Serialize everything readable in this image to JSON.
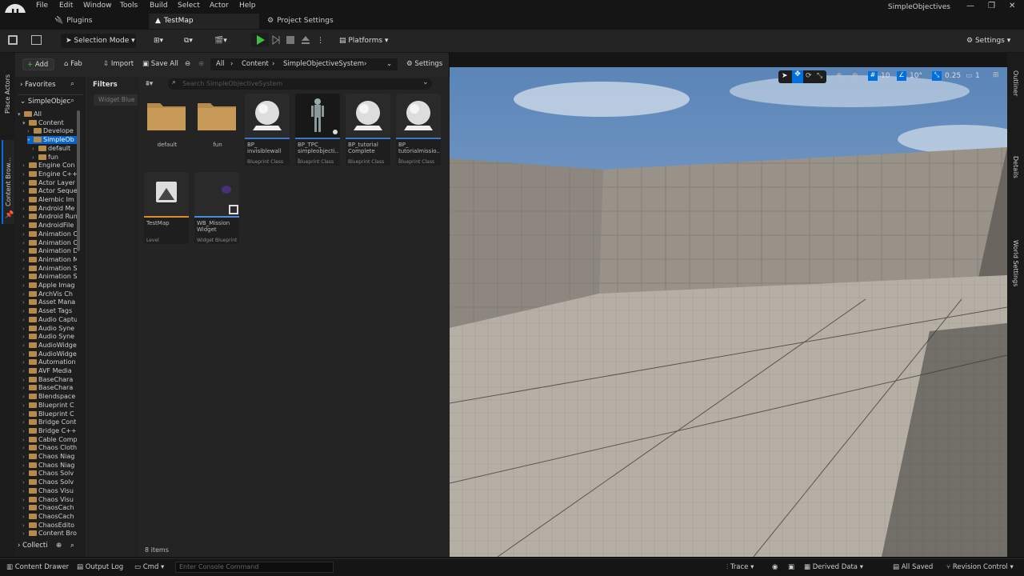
{
  "menu": [
    "File",
    "Edit",
    "Window",
    "Tools",
    "Build",
    "Select",
    "Actor",
    "Help"
  ],
  "app_title": "SimpleObjectives",
  "doc_tabs": {
    "plugins": "Plugins",
    "testmap": "TestMap",
    "project": "Project Settings"
  },
  "toolbar": {
    "selection_mode": "Selection Mode",
    "platforms": "Platforms",
    "settings": "Settings"
  },
  "left_strip": {
    "place_actors": "Place Actors",
    "content_browser": "Content Brow..."
  },
  "right_strip": {
    "outliner": "Outliner",
    "details": "Details",
    "world_settings": "World Settings"
  },
  "content_browser": {
    "add": "Add",
    "fab": "Fab",
    "import": "Import",
    "save_all": "Save All",
    "breadcrumb": [
      "All",
      "Content",
      "SimpleObjectiveSystem"
    ],
    "settings": "Settings",
    "favorites": "Favorites",
    "root": "SimpleObjec",
    "filters": "Filters",
    "filter_chip": "Widget Blue",
    "search_placeholder": "Search SimpleObjectiveSystem",
    "collections": "Collecti",
    "item_count": "8 items"
  },
  "tree": [
    {
      "label": "All",
      "indent": 0,
      "open": true
    },
    {
      "label": "Content",
      "indent": 1,
      "open": true
    },
    {
      "label": "Develope",
      "indent": 2,
      "open": false
    },
    {
      "label": "SimpleOb",
      "indent": 2,
      "open": true,
      "selected": true
    },
    {
      "label": "default",
      "indent": 3,
      "open": false
    },
    {
      "label": "fun",
      "indent": 3,
      "open": false
    },
    {
      "label": "Engine Con",
      "indent": 1
    },
    {
      "label": "Engine C++",
      "indent": 1
    },
    {
      "label": "Actor Layer",
      "indent": 1
    },
    {
      "label": "Actor Seque",
      "indent": 1
    },
    {
      "label": "Alembic Im",
      "indent": 1
    },
    {
      "label": "Android Me",
      "indent": 1
    },
    {
      "label": "Android Run",
      "indent": 1
    },
    {
      "label": "AndroidFile",
      "indent": 1
    },
    {
      "label": "Animation C",
      "indent": 1
    },
    {
      "label": "Animation C",
      "indent": 1
    },
    {
      "label": "Animation D",
      "indent": 1
    },
    {
      "label": "Animation M",
      "indent": 1
    },
    {
      "label": "Animation S",
      "indent": 1
    },
    {
      "label": "Animation S",
      "indent": 1
    },
    {
      "label": "Apple Imag",
      "indent": 1
    },
    {
      "label": "ArchVis Ch",
      "indent": 1
    },
    {
      "label": "Asset Mana",
      "indent": 1
    },
    {
      "label": "Asset Tags",
      "indent": 1
    },
    {
      "label": "Audio Captu",
      "indent": 1
    },
    {
      "label": "Audio Syne",
      "indent": 1
    },
    {
      "label": "Audio Syne",
      "indent": 1
    },
    {
      "label": "AudioWidge",
      "indent": 1
    },
    {
      "label": "AudioWidge",
      "indent": 1
    },
    {
      "label": "Automation",
      "indent": 1
    },
    {
      "label": "AVF Media",
      "indent": 1
    },
    {
      "label": "BaseChara",
      "indent": 1
    },
    {
      "label": "BaseChara",
      "indent": 1
    },
    {
      "label": "Blendspace",
      "indent": 1
    },
    {
      "label": "Blueprint C",
      "indent": 1
    },
    {
      "label": "Blueprint C",
      "indent": 1
    },
    {
      "label": "Bridge Cont",
      "indent": 1
    },
    {
      "label": "Bridge C++",
      "indent": 1
    },
    {
      "label": "Cable Comp",
      "indent": 1
    },
    {
      "label": "Chaos Cloth",
      "indent": 1
    },
    {
      "label": "Chaos Niag",
      "indent": 1
    },
    {
      "label": "Chaos Niag",
      "indent": 1
    },
    {
      "label": "Chaos Solv",
      "indent": 1
    },
    {
      "label": "Chaos Solv",
      "indent": 1
    },
    {
      "label": "Chaos Visu",
      "indent": 1
    },
    {
      "label": "Chaos Visu",
      "indent": 1
    },
    {
      "label": "ChaosCach",
      "indent": 1
    },
    {
      "label": "ChaosCach",
      "indent": 1
    },
    {
      "label": "ChaosEdito",
      "indent": 1
    },
    {
      "label": "Content Bro",
      "indent": 1
    }
  ],
  "assets": [
    {
      "name": "default",
      "type": "",
      "kind": "folder"
    },
    {
      "name": "fun",
      "type": "",
      "kind": "folder"
    },
    {
      "name": "BP_ invisiblewall",
      "type": "Blueprint Class",
      "kind": "sphere"
    },
    {
      "name": "BP_TPC_ simpleobjecti...",
      "type": "Blueprint Class",
      "kind": "mannequin"
    },
    {
      "name": "BP_tutorial Complete",
      "type": "Blueprint Class",
      "kind": "sphere"
    },
    {
      "name": "BP_ tutorialmissio...",
      "type": "Blueprint Class",
      "kind": "sphere"
    },
    {
      "name": "TestMap",
      "type": "Level",
      "kind": "level"
    },
    {
      "name": "WB_Mission Widget",
      "type": "Widget Blueprint",
      "kind": "widget"
    }
  ],
  "viewport_toolbar": {
    "grid": "10",
    "rotate": "10°",
    "scale": "0.25",
    "camera": "1"
  },
  "statusbar": {
    "content_drawer": "Content Drawer",
    "output_log": "Output Log",
    "cmd": "Cmd",
    "console_placeholder": "Enter Console Command",
    "trace": "Trace",
    "derived_data": "Derived Data",
    "all_saved": "All Saved",
    "revision_control": "Revision Control"
  },
  "colors": {
    "accent_blue": "#0070e0",
    "play_green": "#3fbf3f",
    "folder": "#b58a4a",
    "selection": "#0a63c9"
  }
}
